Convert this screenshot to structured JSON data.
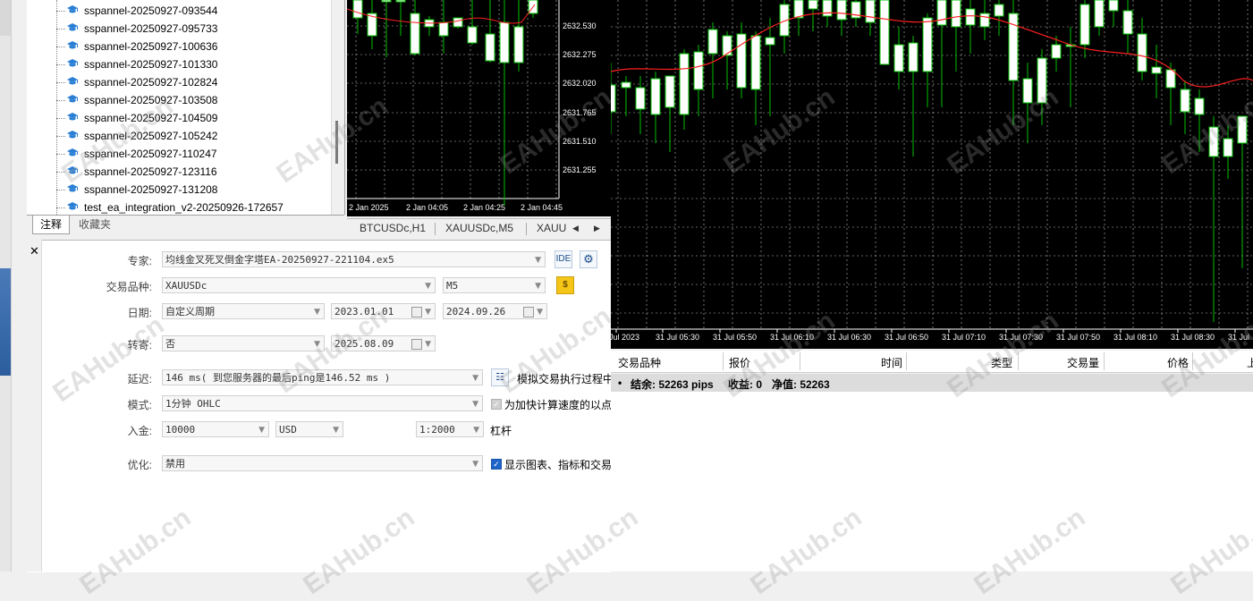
{
  "navigator": {
    "items": [
      "sspannel-20250927-093544",
      "sspannel-20250927-095733",
      "sspannel-20250927-100636",
      "sspannel-20250927-101330",
      "sspannel-20250927-102824",
      "sspannel-20250927-103508",
      "sspannel-20250927-104509",
      "sspannel-20250927-105242",
      "sspannel-20250927-110247",
      "sspannel-20250927-123116",
      "sspannel-20250927-131208",
      "test_ea_integration_v2-20250926-172657"
    ],
    "tabs": [
      "注释",
      "收藏夹"
    ]
  },
  "small_chart": {
    "price_labels": [
      "2632.530",
      "2632.275",
      "2632.020",
      "2631.765",
      "2631.510",
      "2631.255"
    ],
    "time_labels": [
      "2 Jan 2025",
      "2 Jan 04:05",
      "2 Jan 04:25",
      "2 Jan 04:45"
    ]
  },
  "chart_tabs": [
    "BTCUSDc,H1",
    "XAUUSDc,M5",
    "XAUU"
  ],
  "big_chart": {
    "time_labels": [
      "Jul 2023",
      "31 Jul 05:30",
      "31 Jul 05:50",
      "31 Jul 06:10",
      "31 Jul 06:30",
      "31 Jul 06:50",
      "31 Jul 07:10",
      "31 Jul 07:30",
      "31 Jul 07:50",
      "31 Jul 08:10",
      "31 Jul 08:30",
      "31 Jul"
    ]
  },
  "tester": {
    "expert_label": "专家:",
    "expert_value": "均线金叉死叉倒金字塔EA-20250927-221104.ex5",
    "ide_label": "IDE",
    "symbol_label": "交易品种:",
    "symbol_value": "XAUUSDc",
    "period_value": "M5",
    "date_label": "日期:",
    "date_mode": "自定义周期",
    "date_from": "2023.01.01",
    "date_to": "2024.09.26",
    "forward_label": "转寄:",
    "forward_value": "否",
    "forward_date": "2025.08.09",
    "delay_label": "延迟:",
    "delay_value": "146 ms( 到您服务器的最后ping是146.52 ms )",
    "delay_check_text": "模拟交易执行过程中",
    "mode_label": "模式:",
    "mode_value": "1分钟 OHLC",
    "mode_check_text": "为加快计算速度的以点",
    "deposit_label": "入金:",
    "deposit_value": "10000",
    "currency_value": "USD",
    "leverage_value": "1:2000",
    "leverage_label": "杠杆",
    "optimize_label": "优化:",
    "optimize_value": "禁用",
    "visual_check_text": "显示图表、指标和交易"
  },
  "trade_table": {
    "headers": [
      "交易品种",
      "报价",
      "时间",
      "类型",
      "交易量",
      "价格",
      "上"
    ],
    "balance_bullet": "•",
    "balance_text": "结余: 52263 pips",
    "profit_text": "收益: 0",
    "equity_text": "净值: 52263"
  },
  "watermark": "EAHub.cn",
  "colors": {
    "chart_bg": "#000000",
    "bull_candle": "#ffffff",
    "wick": "#00c000",
    "ma_line": "#ff2020",
    "grid": "#c0c0c0"
  }
}
